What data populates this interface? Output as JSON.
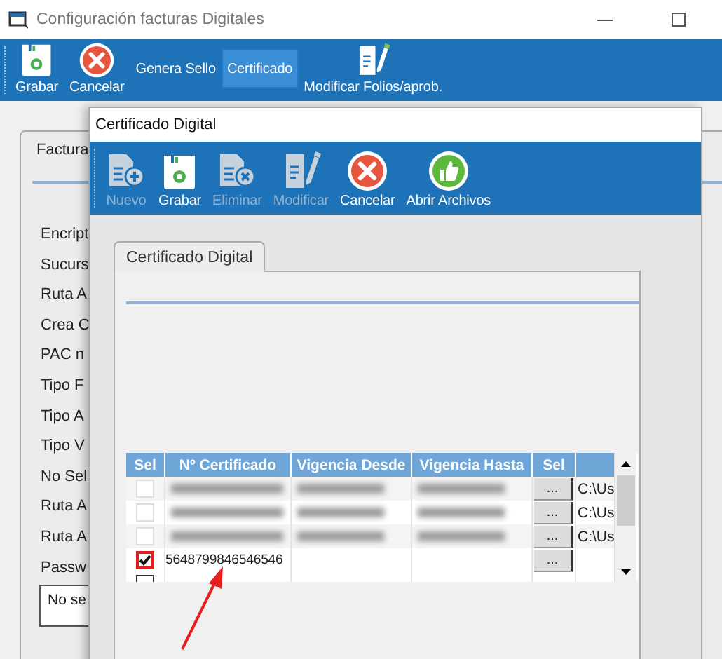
{
  "window": {
    "title": "Configuración facturas Digitales"
  },
  "toolbar": [
    {
      "label": "Grabar",
      "kind": "save",
      "selected": false
    },
    {
      "label": "Cancelar",
      "kind": "cancel",
      "selected": false
    },
    {
      "label": "Genera Sello",
      "kind": "none",
      "selected": false
    },
    {
      "label": "Certificado",
      "kind": "none",
      "selected": true
    },
    {
      "label": "Modificar Folios/aprob.",
      "kind": "edit",
      "selected": false
    }
  ],
  "main_tab": {
    "label": "Factura"
  },
  "fields": [
    "Encript",
    "Sucurs",
    "Ruta A",
    "Crea C",
    "PAC n",
    "Tipo F",
    "Tipo A",
    "Tipo V",
    "No Sell",
    "Ruta A",
    "Ruta A",
    "Passw"
  ],
  "message_box": {
    "text": "No se"
  },
  "dialog": {
    "title": "Certificado Digital",
    "toolbar": [
      {
        "label": "Nuevo",
        "kind": "new",
        "disabled": true
      },
      {
        "label": "Grabar",
        "kind": "save",
        "disabled": false
      },
      {
        "label": "Eliminar",
        "kind": "delete",
        "disabled": true
      },
      {
        "label": "Modificar",
        "kind": "edit",
        "disabled": true
      },
      {
        "label": "Cancelar",
        "kind": "cancel",
        "disabled": false
      },
      {
        "label": "Abrir Archivos",
        "kind": "thumb",
        "disabled": false
      }
    ],
    "tab": {
      "label": "Certificado Digital"
    },
    "table": {
      "columns": [
        "Sel",
        "Nº Certificado",
        "Vigencia Desde",
        "Vigencia Hasta",
        "Sel"
      ],
      "rows": [
        {
          "checked": false,
          "redacted": true,
          "highlighted": false,
          "certificate": "",
          "button": "...",
          "path": "C:\\Us"
        },
        {
          "checked": false,
          "redacted": true,
          "highlighted": false,
          "certificate": "",
          "button": "...",
          "path": "C:\\Us"
        },
        {
          "checked": false,
          "redacted": true,
          "highlighted": false,
          "certificate": "",
          "button": "...",
          "path": "C:\\Us"
        },
        {
          "checked": true,
          "highlighted": true,
          "certificate": "5648799846546546",
          "button": "...",
          "path": ""
        },
        {
          "checked": false,
          "highlighted": false,
          "certificate": "",
          "button": "",
          "path": ""
        }
      ]
    }
  }
}
